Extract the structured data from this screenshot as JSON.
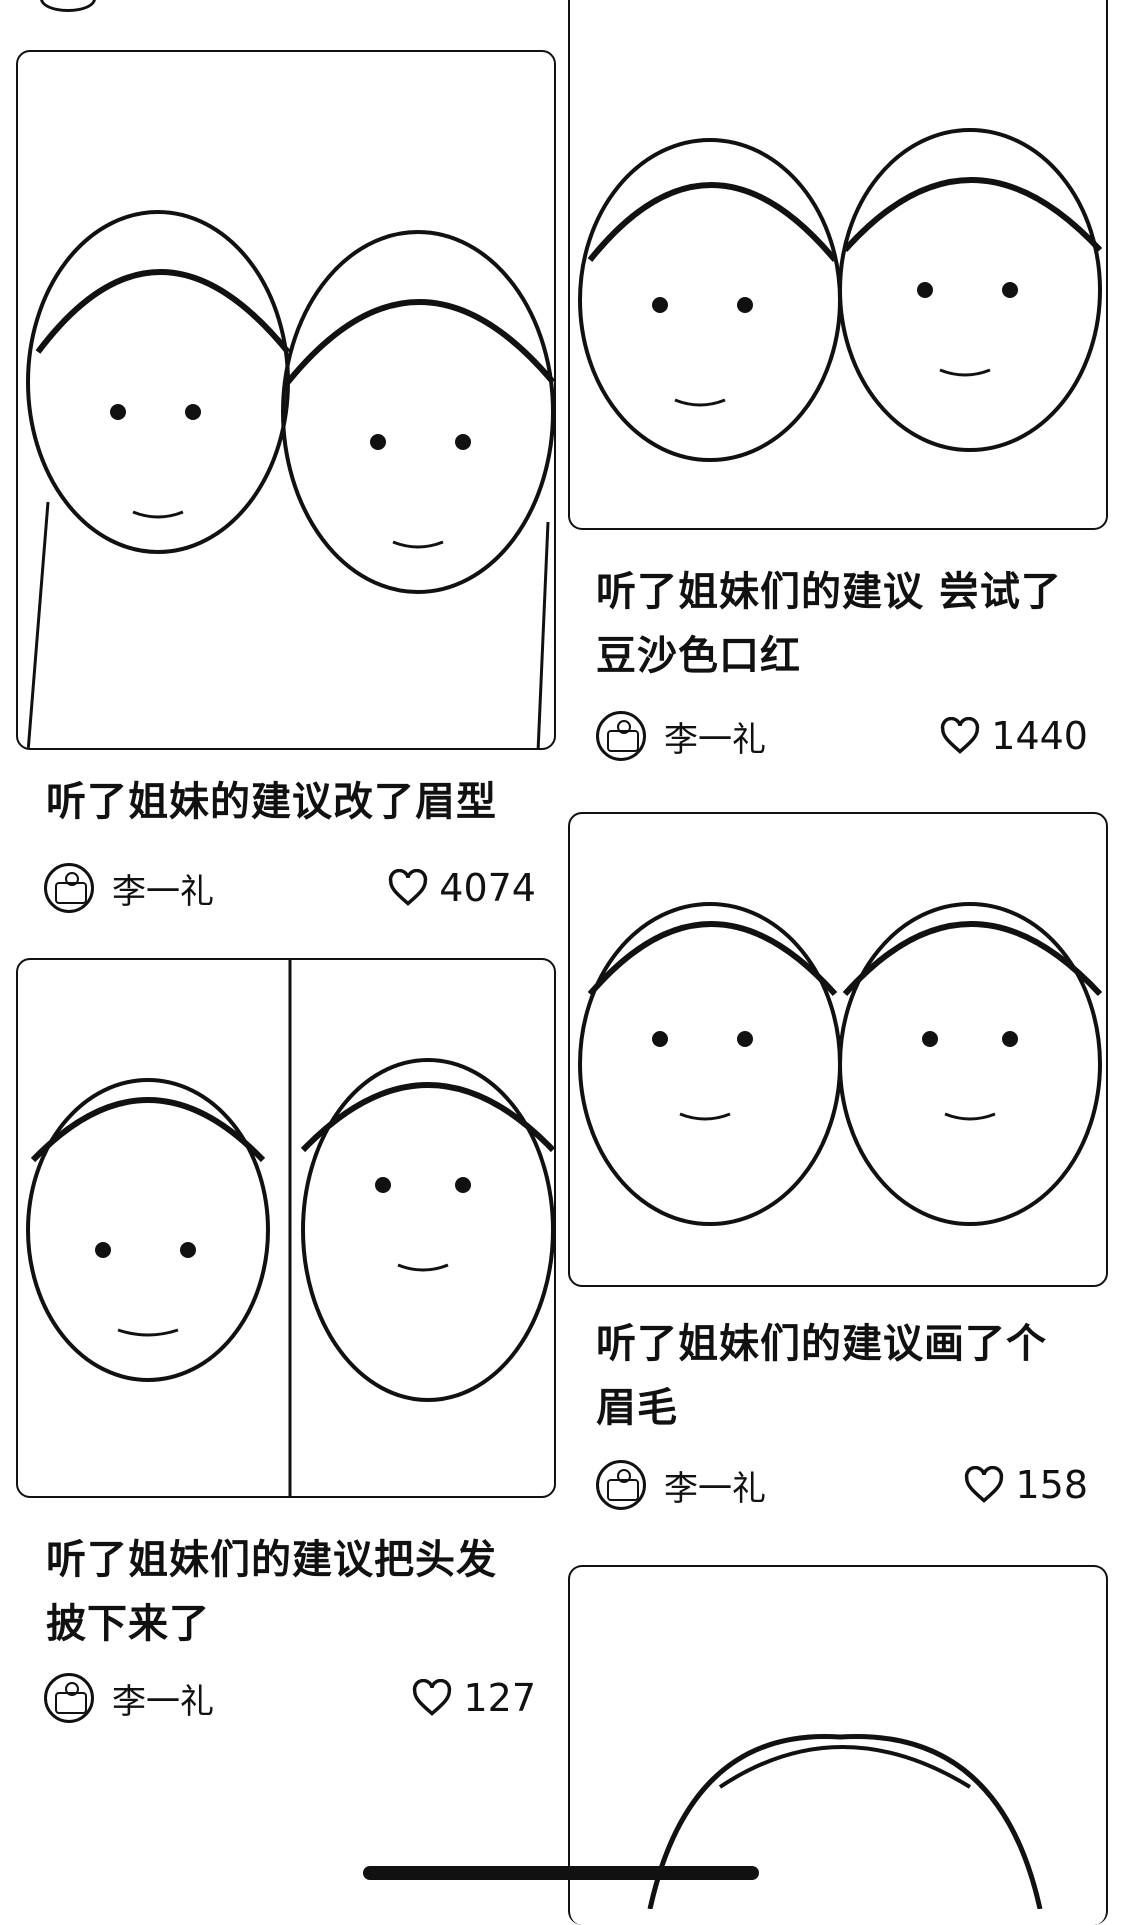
{
  "feed": {
    "posts": [
      {
        "title": "听了姐妹的建议改了眉型",
        "author": "李一礼",
        "likes": "4074"
      },
      {
        "title": "听了姐妹们的建议 尝试了豆沙色口红",
        "author": "李一礼",
        "likes": "1440"
      },
      {
        "title": "听了姐妹们的建议把头发披下来了",
        "author": "李一礼",
        "likes": "127"
      },
      {
        "title": "听了姐妹们的建议画了个眉毛",
        "author": "李一礼",
        "likes": "158"
      }
    ]
  }
}
